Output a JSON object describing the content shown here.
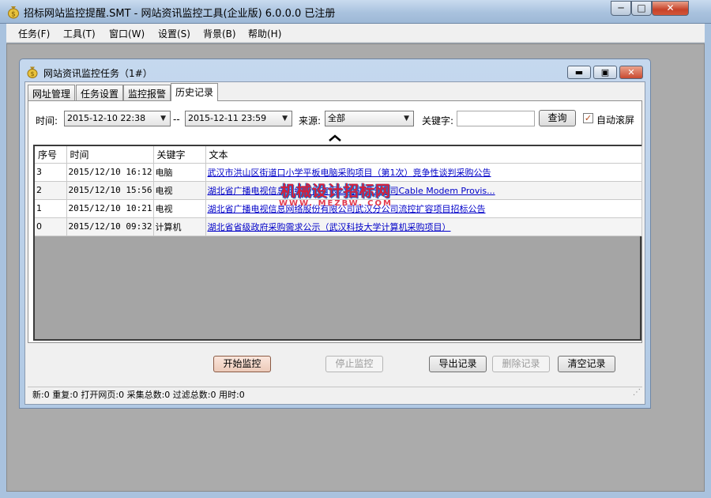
{
  "window": {
    "title": "招标网站监控提醒.SMT  - 网站资讯监控工具(企业版) 6.0.0.0  已注册",
    "min_label": "─",
    "max_label": "□",
    "close_label": "✕"
  },
  "menu": {
    "items": [
      "任务(F)",
      "工具(T)",
      "窗口(W)",
      "设置(S)",
      "背景(B)",
      "帮助(H)"
    ]
  },
  "child": {
    "title": "网站资讯监控任务（1#）",
    "min_label": "▬",
    "max_label": "▣",
    "close_label": "✕"
  },
  "tabs": [
    {
      "label": "网址管理",
      "active": false
    },
    {
      "label": "任务设置",
      "active": false
    },
    {
      "label": "监控报警",
      "active": false
    },
    {
      "label": "历史记录",
      "active": true
    }
  ],
  "filters": {
    "time_label": "时间:",
    "time_from": "2015-12-10 22:38",
    "time_sep": "--",
    "time_to": "2015-12-11 23:59",
    "source_label": "来源:",
    "source_value": "全部",
    "keyword_label": "关键字:",
    "keyword_value": "",
    "query_button": "查询",
    "autoscroll_label": "自动滚屏",
    "autoscroll_checked": true
  },
  "table": {
    "headers": [
      "序号",
      "时间",
      "关键字",
      "文本"
    ],
    "rows": [
      {
        "id": "3",
        "time": "2015/12/10 16:12",
        "keyword": "电脑",
        "text": "武汉市洪山区街道口小学平板电脑采购项目（第1次）竞争性谈判采购公告"
      },
      {
        "id": "2",
        "time": "2015/12/10 15:56",
        "keyword": "电视",
        "text": "湖北省广播电视信息网络股份有限公司武汉分公司Cable Modem Provis..."
      },
      {
        "id": "1",
        "time": "2015/12/10 10:21",
        "keyword": "电视",
        "text": "湖北省广播电视信息网络股份有限公司武汉分公司流控扩容项目招标公告"
      },
      {
        "id": "0",
        "time": "2015/12/10 09:32",
        "keyword": "计算机",
        "text": "湖北省省级政府采购需求公示（武汉科技大学计算机采购项目）"
      }
    ]
  },
  "watermark": {
    "line1": "机械设计招标网",
    "line2": "WWW. MEZBW. COM"
  },
  "actions": {
    "start": "开始监控",
    "stop": "停止监控",
    "export": "导出记录",
    "delete": "删除记录",
    "clear": "清空记录"
  },
  "status": "新:0  重复:0  打开网页:0  采集总数:0  过滤总数:0  用时:0",
  "icons": {
    "app": "money-bag-icon",
    "child": "money-bag-icon",
    "dropdown": "chevron-down-icon",
    "caret": "caret-up-icon",
    "grip": "resize-grip-icon"
  },
  "colors": {
    "titlebar": "#a9c2de",
    "link": "#0000c8",
    "grid_empty": "#a5a5a5",
    "watermark_red": "#d61e3a",
    "watermark_blue": "#1a6fd1"
  }
}
